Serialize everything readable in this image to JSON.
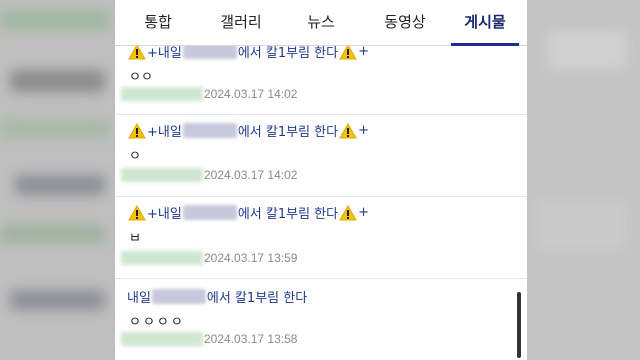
{
  "tabs": [
    {
      "label": "통합",
      "active": false
    },
    {
      "label": "갤러리",
      "active": false
    },
    {
      "label": "뉴스",
      "active": false
    },
    {
      "label": "동영상",
      "active": false
    },
    {
      "label": "게시물",
      "active": true
    }
  ],
  "posts": [
    {
      "title_prefix": "+내일",
      "title_suffix": "에서 칼1부림 한다",
      "title_plus": "+",
      "has_warning": true,
      "body": "ㅇㅇ",
      "date": "2024.03.17 14:02"
    },
    {
      "title_prefix": "+내일",
      "title_suffix": "에서 칼1부림 한다",
      "title_plus": "+",
      "has_warning": true,
      "body": "ㅇ",
      "date": "2024.03.17 14:02"
    },
    {
      "title_prefix": "+내일",
      "title_suffix": "에서 칼1부림 한다",
      "title_plus": "+",
      "has_warning": true,
      "body": "ㅂ",
      "date": "2024.03.17 13:59"
    },
    {
      "title_prefix": "내일",
      "title_suffix": "에서 칼1부림 한다",
      "title_plus": "",
      "has_warning": false,
      "body": "ㅇㅇㅇㅇ",
      "date": "2024.03.17 13:58"
    }
  ],
  "colors": {
    "accent": "#1e2b8c",
    "title_text": "#1f3a8a",
    "date_text": "#8a8a8a"
  }
}
